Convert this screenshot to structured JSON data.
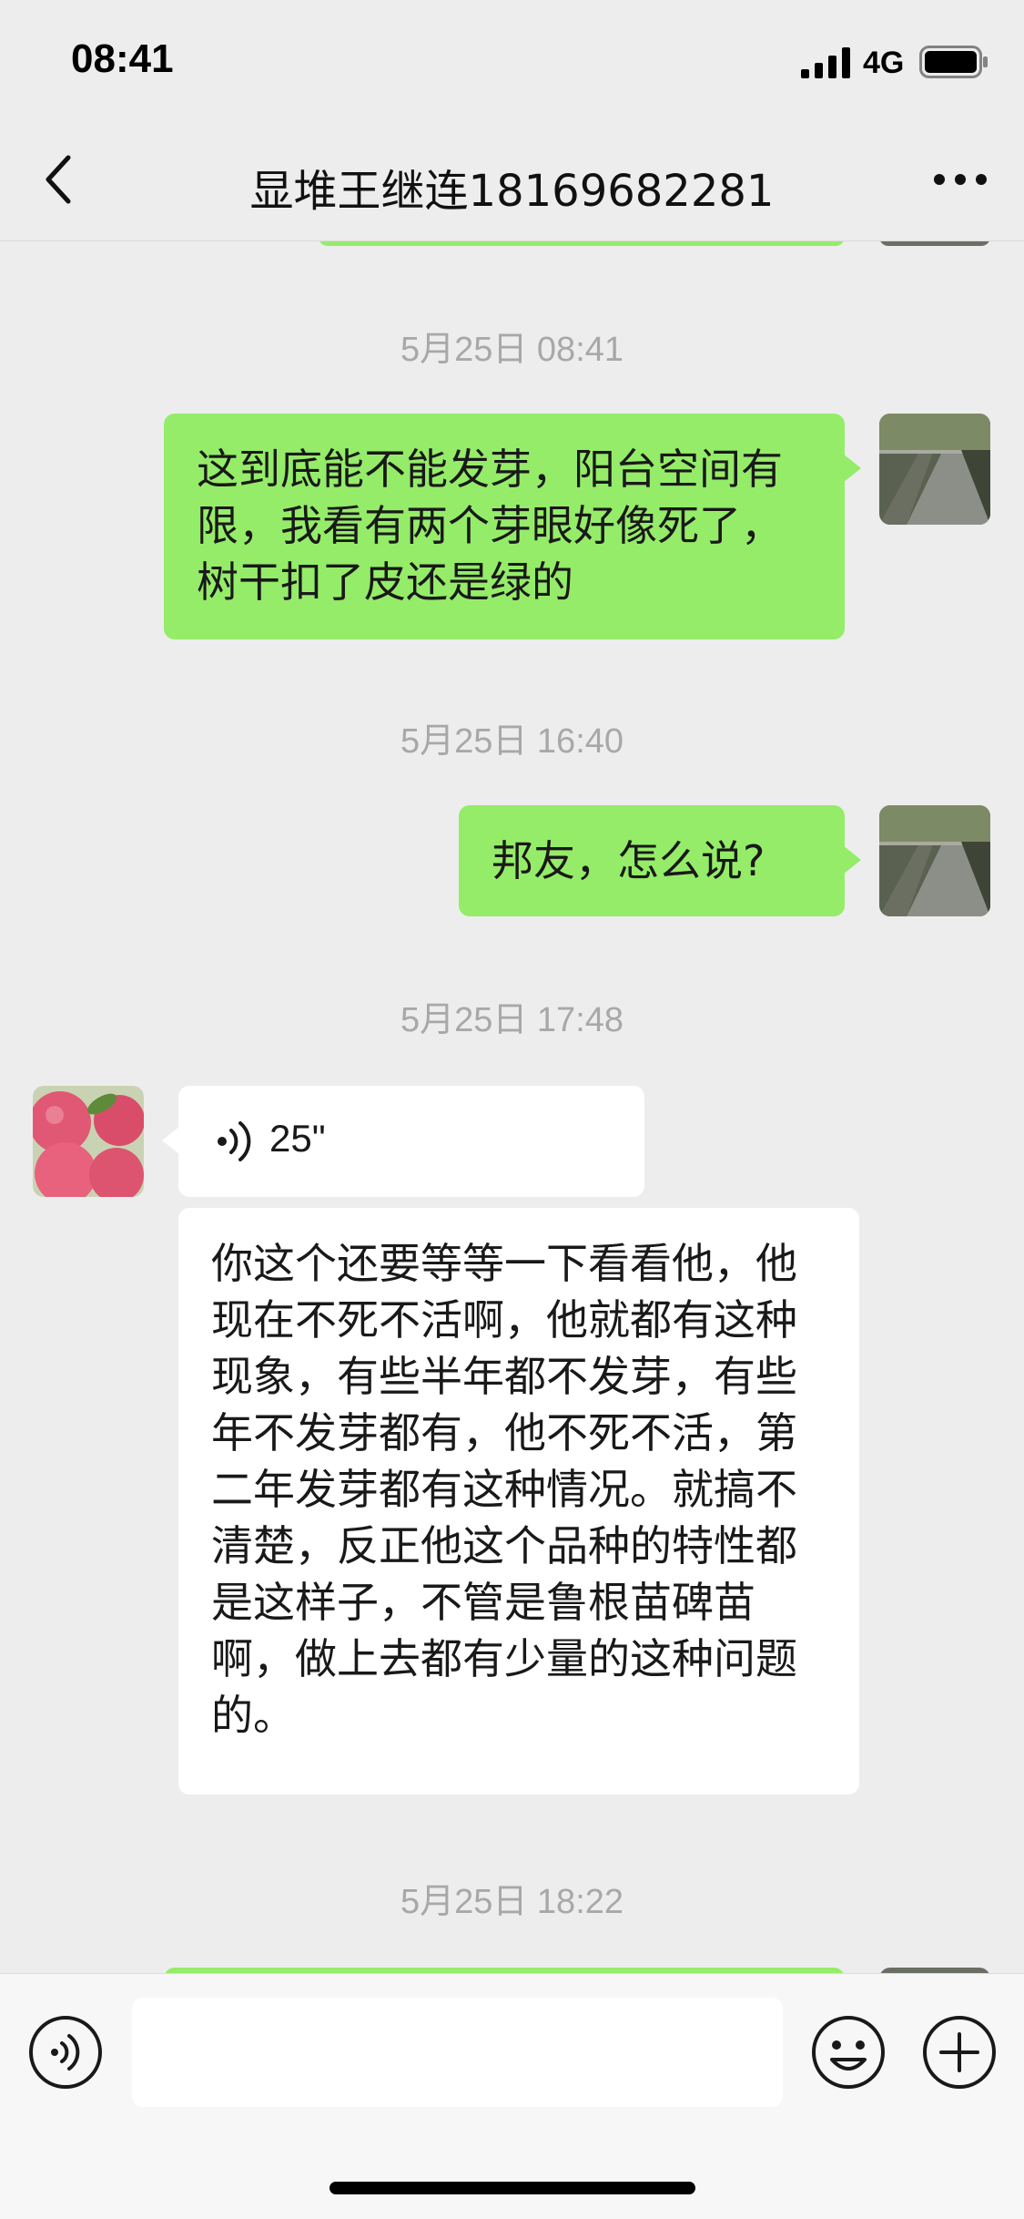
{
  "status_bar": {
    "time": "08:41",
    "network": "4G",
    "signal_icon": "cellular-signal-icon",
    "battery_icon": "battery-icon"
  },
  "header": {
    "title": "显堆王继连18169682281",
    "back_icon": "chevron-left-icon",
    "more_icon": "more-horizontal-icon"
  },
  "messages": [
    {
      "type": "timestamp",
      "text": "5月25日 08:41"
    },
    {
      "type": "text",
      "direction": "sent",
      "text": "这到底能不能发芽，阳台空间有限，我看有两个芽眼好像死了，树干扣了皮还是绿的"
    },
    {
      "type": "timestamp",
      "text": "5月25日 16:40"
    },
    {
      "type": "text",
      "direction": "sent",
      "text": "邦友，怎么说?"
    },
    {
      "type": "timestamp",
      "text": "5月25日 17:48"
    },
    {
      "type": "voice",
      "direction": "received",
      "duration": "25\""
    },
    {
      "type": "text",
      "direction": "received",
      "text": "你这个还要等等一下看看他，他现在不死不活啊，他就都有这种现象，有些半年都不发芽，有些年不发芽都有，他不死不活，第二年发芽都有这种情况。就搞不清楚，反正他这个品种的特性都是这样子，不管是鲁根苗碑苗啊，做上去都有少量的这种问题的。"
    },
    {
      "type": "timestamp",
      "text": "5月25日 18:22"
    }
  ],
  "input_bar": {
    "placeholder": "",
    "voice_icon": "voice-input-icon",
    "emoji_icon": "emoji-icon",
    "add_icon": "plus-circle-icon"
  },
  "colors": {
    "background": "#ededed",
    "sent_bubble": "#95ec69",
    "received_bubble": "#ffffff",
    "timestamp": "#a8a8a8"
  }
}
